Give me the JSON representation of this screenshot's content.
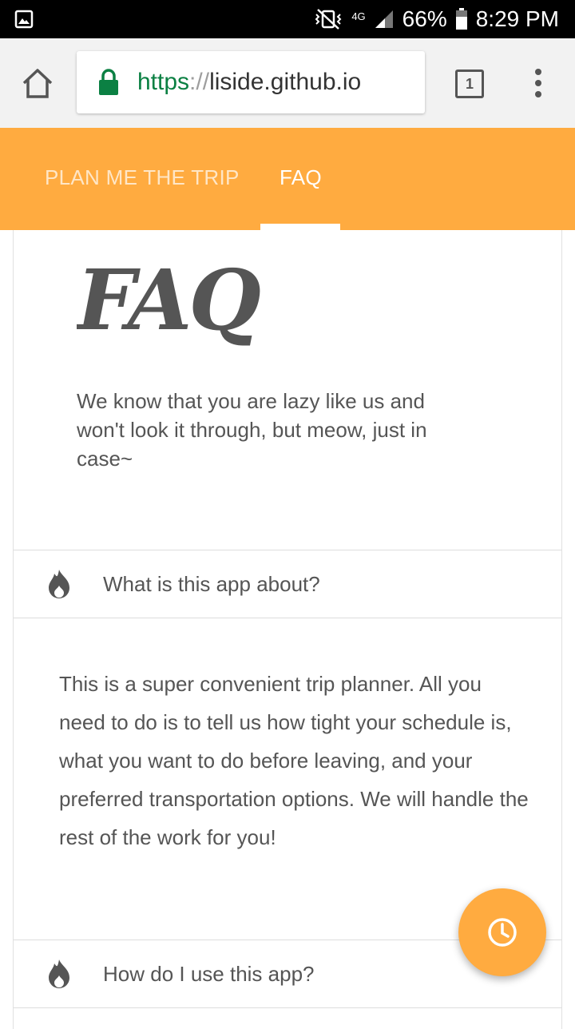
{
  "status_bar": {
    "network": "4G",
    "battery": "66%",
    "time": "8:29 PM"
  },
  "browser": {
    "url_scheme": "https",
    "url_sep": "://",
    "url_host": "liside.github.io",
    "tab_count": "1"
  },
  "nav": {
    "tabs": [
      {
        "label": "PLAN ME THE TRIP"
      },
      {
        "label": "FAQ"
      }
    ]
  },
  "page": {
    "title": "FAQ",
    "intro": "We know that you are lazy like us and won't look it through, but meow, just in case~"
  },
  "faq": [
    {
      "question": "What is this app about?",
      "answer": "This is a super convenient trip planner. All you need to do is to tell us how tight your schedule is, what you want to do before leaving, and your preferred transportation options. We will handle the rest of the work for you!"
    },
    {
      "question": "How do I use this app?"
    }
  ],
  "colors": {
    "accent": "#ffab40",
    "text": "#555555",
    "lock": "#0b8043"
  },
  "icons": {
    "faq_item": "flame-icon",
    "fab": "clock-icon"
  }
}
